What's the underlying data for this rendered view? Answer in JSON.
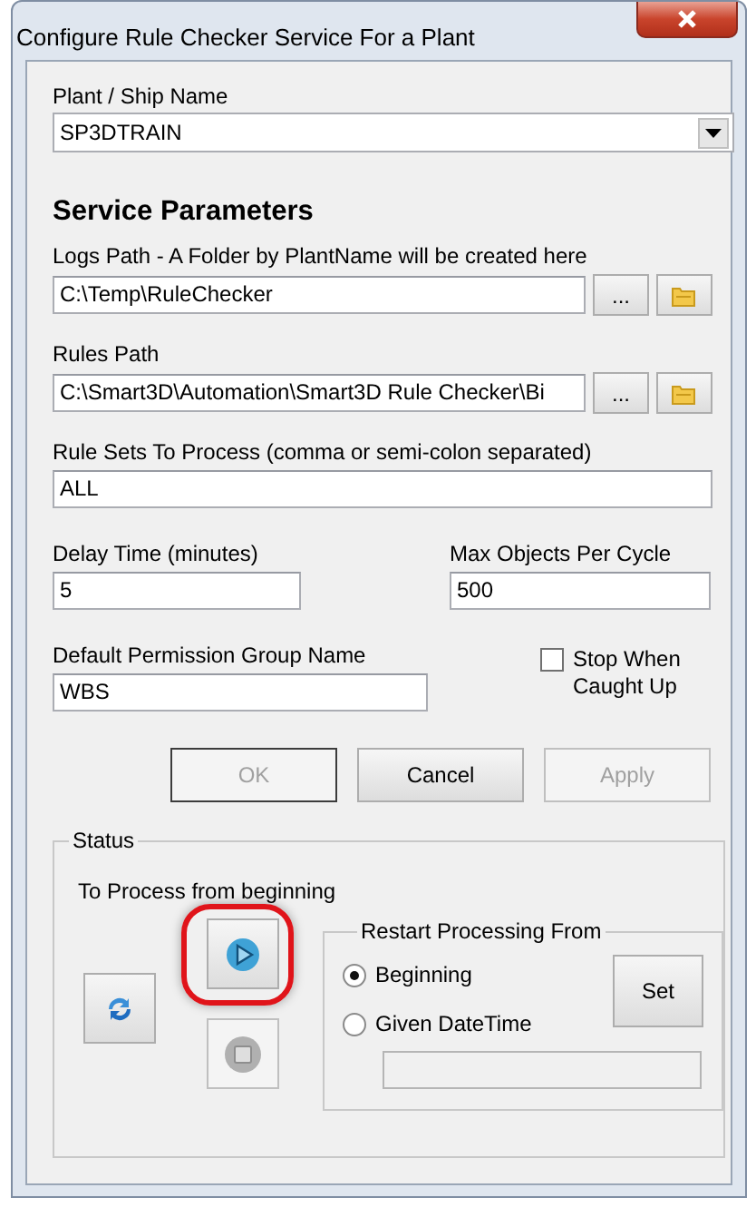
{
  "window": {
    "title": "Configure Rule Checker Service For a Plant"
  },
  "plant": {
    "label": "Plant / Ship Name",
    "value": "SP3DTRAIN"
  },
  "section_title": "Service Parameters",
  "logs_path": {
    "label": "Logs Path - A Folder by PlantName will be created here",
    "value": "C:\\Temp\\RuleChecker",
    "browse": "..."
  },
  "rules_path": {
    "label": "Rules Path",
    "value": "C:\\Smart3D\\Automation\\Smart3D Rule Checker\\Bi",
    "browse": "..."
  },
  "rule_sets": {
    "label": "Rule Sets To Process (comma or semi-colon separated)",
    "value": "ALL"
  },
  "delay_time": {
    "label": "Delay Time (minutes)",
    "value": "5"
  },
  "max_objects": {
    "label": "Max Objects Per Cycle",
    "value": "500"
  },
  "permission_group": {
    "label": "Default Permission Group Name",
    "value": "WBS"
  },
  "stop_when_caught_up": {
    "label": "Stop When Caught Up",
    "checked": false
  },
  "buttons": [
    {
      "label": "OK",
      "disabled": true
    },
    {
      "label": "Cancel",
      "disabled": false
    },
    {
      "label": "Apply",
      "disabled": true
    }
  ],
  "status": {
    "title": "Status",
    "message": "To Process from beginning",
    "restart": {
      "title": "Restart Processing From",
      "options": [
        {
          "label": "Beginning",
          "selected": true
        },
        {
          "label": "Given DateTime",
          "selected": false
        }
      ],
      "set_button": "Set"
    }
  }
}
